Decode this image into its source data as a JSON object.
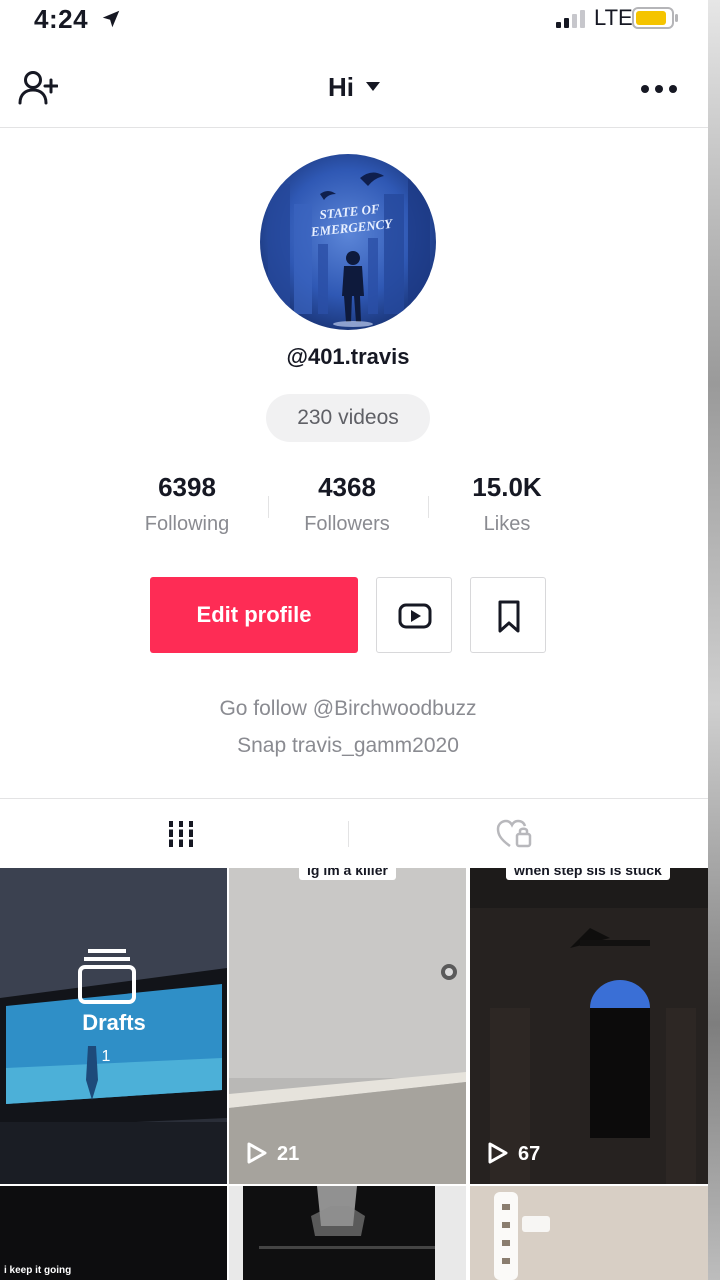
{
  "status_bar": {
    "time": "4:24",
    "network": "LTE",
    "battery_color": "#f5c400"
  },
  "header": {
    "title": "Hi",
    "icons": [
      "add-user-icon",
      "chevron-down-icon",
      "more-icon"
    ]
  },
  "profile": {
    "avatar_text": "STATE OF EMERGENCY",
    "username": "@401.travis",
    "video_count": "230 videos",
    "stats": [
      {
        "value": "6398",
        "label": "Following"
      },
      {
        "value": "4368",
        "label": "Followers"
      },
      {
        "value": "15.0K",
        "label": "Likes"
      }
    ],
    "edit_profile_label": "Edit profile",
    "bio": [
      "Go follow @Birchwoodbuzz",
      "Snap travis_gamm2020"
    ]
  },
  "tabs": [
    {
      "name": "videos",
      "icon": "grid-icon"
    },
    {
      "name": "liked",
      "icon": "private-heart-icon"
    }
  ],
  "grid": {
    "drafts": {
      "label": "Drafts",
      "count": "1"
    },
    "tiles": [
      {
        "caption": "ig im a killer",
        "views": "21"
      },
      {
        "caption": "when step sis is stuck",
        "views": "67"
      },
      {
        "caption": "i keep it going"
      }
    ]
  },
  "colors": {
    "accent": "#fe2c55",
    "text": "#161823",
    "muted": "#8a8b91"
  }
}
